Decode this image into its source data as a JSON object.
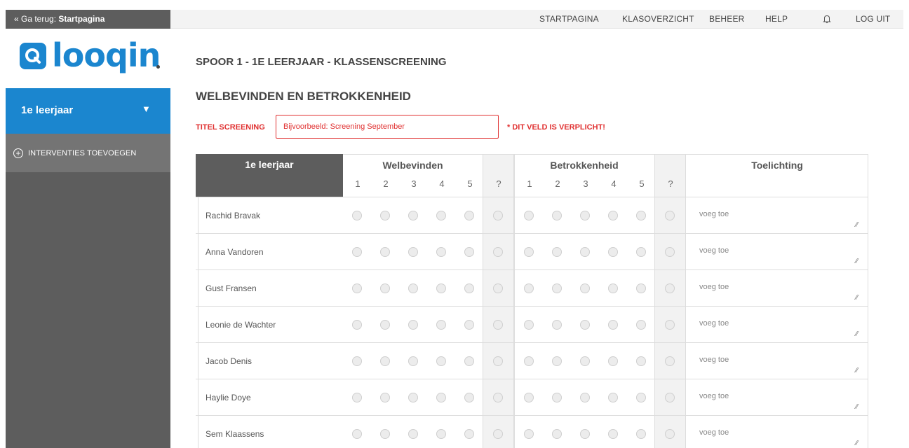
{
  "topbar": {
    "back_prefix": "« Ga terug: ",
    "back_target": "Startpagina",
    "nav": [
      "STARTPAGINA",
      "KLASOVERZICHT",
      "BEHEER",
      "HELP",
      "LOG UIT"
    ]
  },
  "sidebar": {
    "logo_text": "looqin",
    "class_label": "1e leerjaar",
    "interventions_label": "INTERVENTIES TOEVOEGEN"
  },
  "main": {
    "page_title": "SPOOR 1 - 1E LEERJAAR - KLASSENSCREENING",
    "section_title": "WELBEVINDEN EN BETROKKENHEID",
    "titel_label": "TITEL SCREENING",
    "titel_placeholder": "Bijvoorbeeld: Screening September",
    "required_text": "* DIT VELD IS VERPLICHT!"
  },
  "table": {
    "class_header": "1e leerjaar",
    "group1": "Welbevinden",
    "group2": "Betrokkenheid",
    "notes_header": "Toelichting",
    "scale": [
      "1",
      "2",
      "3",
      "4",
      "5"
    ],
    "unknown": "?",
    "note_placeholder": "voeg toe",
    "students": [
      "Rachid Bravak",
      "Anna Vandoren",
      "Gust Fransen",
      "Leonie de Wachter",
      "Jacob Denis",
      "Haylie Doye",
      "Sem Klaassens"
    ]
  },
  "colors": {
    "accent": "#1b86cf",
    "sidebar": "#5d5d5d",
    "error": "#e03131"
  }
}
